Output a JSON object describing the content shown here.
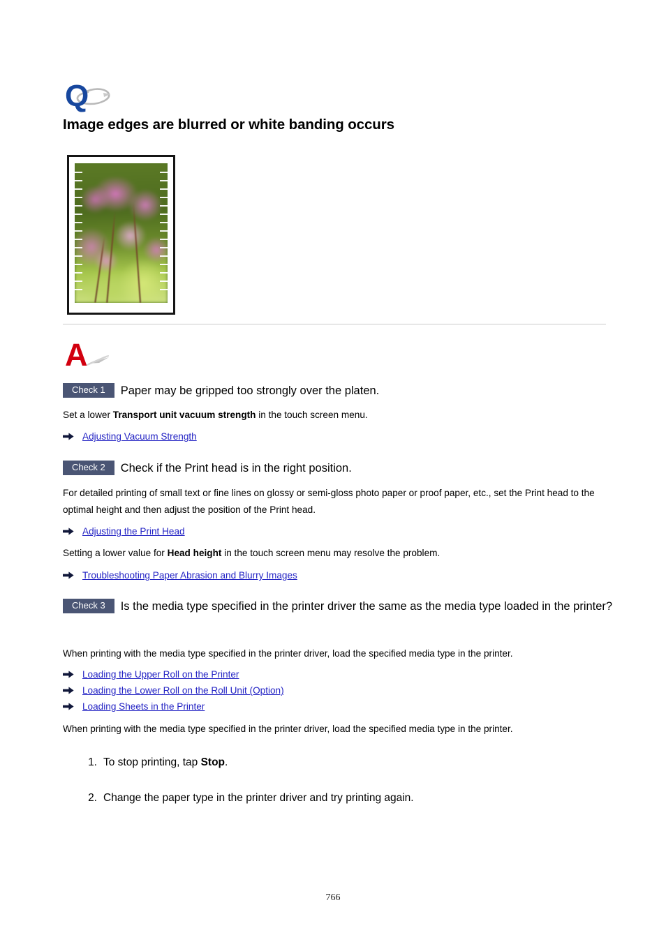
{
  "document": {
    "page_number": "766",
    "title": "Image edges are blurred or white banding occurs"
  },
  "icons": {
    "question_mark": "q-mark-icon",
    "answer_mark": "a-mark-icon",
    "arrow_bullet": "arrow-bullet-icon"
  },
  "colors": {
    "question_blue": "#17479e",
    "answer_red": "#d2000f",
    "badge_bg": "#4a5574",
    "link_blue": "#2323c4",
    "divider": "#cbcbcb"
  },
  "sample_image": {
    "alt": "Printed photo of pink orchid flowers showing white banding at the left and right edges"
  },
  "checks": [
    {
      "badge": "Check 1",
      "title": "Paper may be gripped too strongly over the platen.",
      "paragraphs": [
        {
          "pre": "Set a lower ",
          "bold": "Transport unit vacuum strength",
          "post": " in the touch screen menu."
        }
      ],
      "links": [
        "Adjusting Vacuum Strength"
      ]
    },
    {
      "badge": "Check 2",
      "title": "Check if the Print head is in the right position.",
      "paragraphs": [
        {
          "pre": "For detailed printing of small text or fine lines on glossy or semi-gloss photo paper or proof paper, etc., set the Print head to the optimal height and then adjust the position of the Print head.",
          "bold": "",
          "post": ""
        },
        {
          "pre": "Setting a lower value for ",
          "bold": "Head height",
          "post": " in the touch screen menu may resolve the problem."
        }
      ],
      "links": [
        "Adjusting the Print Head",
        "Troubleshooting Paper Abrasion and Blurry Images"
      ]
    },
    {
      "badge": "Check 3",
      "title": "Is the media type specified in the printer driver the same as the media type loaded in the printer?",
      "paragraphs": [
        {
          "pre": "When printing with the media type specified in the printer driver, load the specified media type in the printer.",
          "bold": "",
          "post": ""
        },
        {
          "pre": "When printing with the media type specified in the printer driver, load the specified media type in the printer.",
          "bold": "",
          "post": ""
        }
      ],
      "links": [
        "Loading the Upper Roll on the Printer",
        "Loading the Lower Roll on the Roll Unit (Option)",
        "Loading Sheets in the Printer"
      ]
    }
  ],
  "steps": [
    {
      "number": "1.",
      "pre": "To stop printing, tap ",
      "bold": "Stop",
      "post": "."
    },
    {
      "number": "2.",
      "pre": "Change the paper type in the printer driver and try printing again.",
      "bold": "",
      "post": ""
    }
  ]
}
